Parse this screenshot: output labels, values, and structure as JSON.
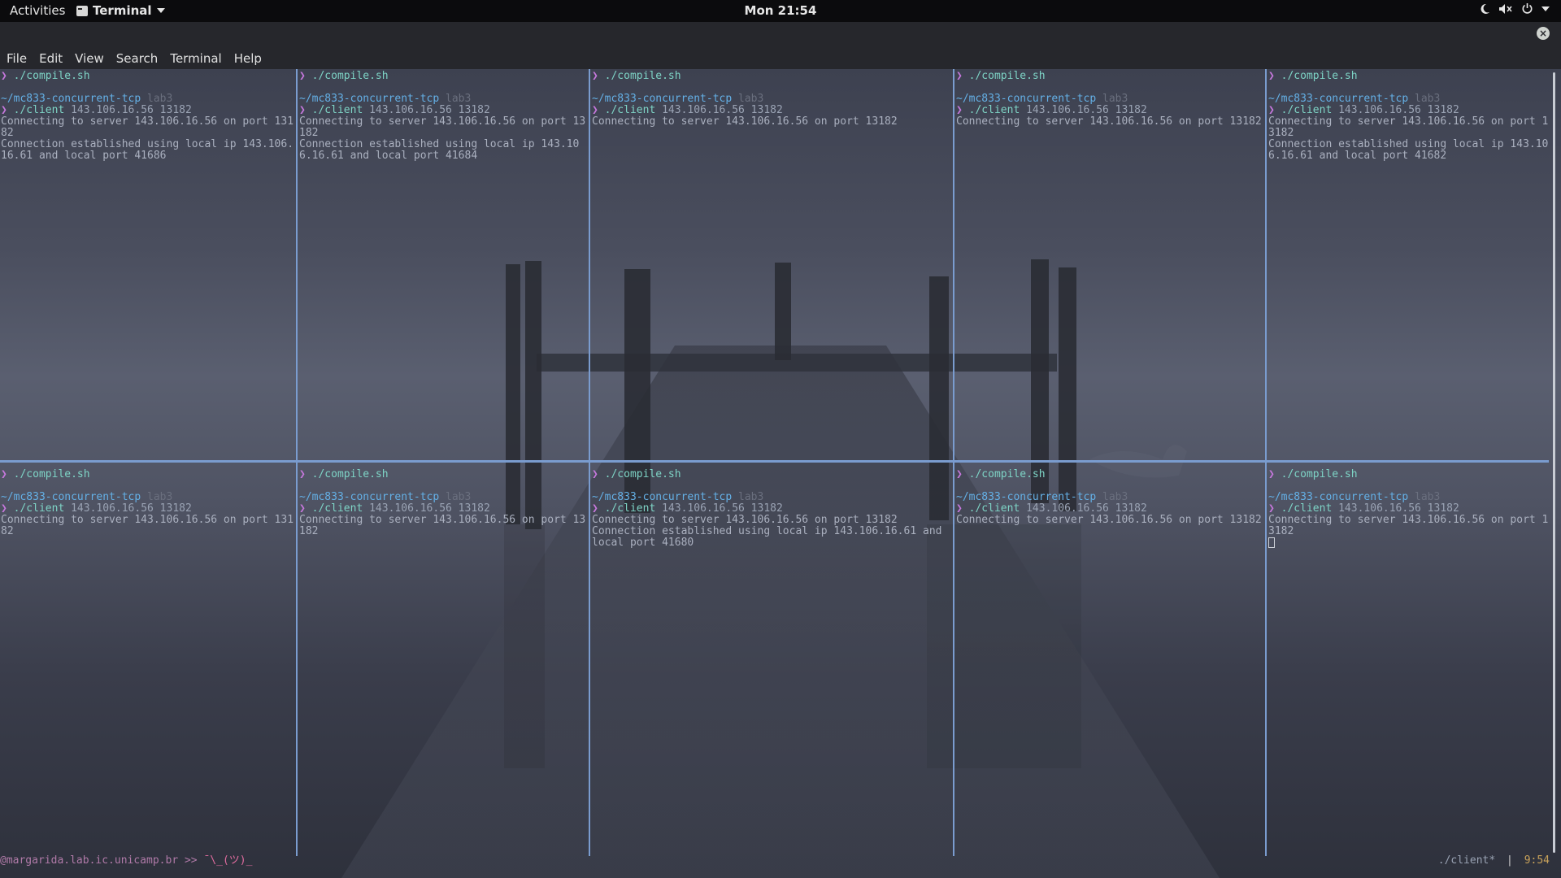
{
  "topbar": {
    "activities": "Activities",
    "app_name": "Terminal",
    "clock": "Mon 21:54",
    "tray_icons": [
      "night-light-icon",
      "volume-muted-icon",
      "power-icon",
      "chevron-down-icon"
    ]
  },
  "menubar": [
    "File",
    "Edit",
    "View",
    "Search",
    "Terminal",
    "Help"
  ],
  "panes": [
    {
      "lines": [
        {
          "sym": "❯",
          "cmd": "./compile.sh",
          "args": ""
        },
        {
          "blank": true
        },
        {
          "path": "~/mc833-concurrent-tcp",
          "branch": "lab3"
        },
        {
          "sym": "❯",
          "cmd": "./client",
          "args": "143.106.16.56 13182"
        },
        {
          "out": "Connecting to server 143.106.16.56 on port 13182"
        },
        {
          "out": "Connection established using local ip 143.106.16.61 and local port 41686"
        }
      ]
    },
    {
      "lines": [
        {
          "sym": "❯",
          "cmd": "./compile.sh",
          "args": ""
        },
        {
          "blank": true
        },
        {
          "path": "~/mc833-concurrent-tcp",
          "branch": "lab3"
        },
        {
          "sym": "❯",
          "cmd": "./client",
          "args": "143.106.16.56 13182"
        },
        {
          "out": "Connecting to server 143.106.16.56 on port 13182"
        },
        {
          "out": "Connection established using local ip 143.106.16.61 and local port 41684"
        }
      ]
    },
    {
      "lines": [
        {
          "sym": "❯",
          "cmd": "./compile.sh",
          "args": ""
        },
        {
          "blank": true
        },
        {
          "path": "~/mc833-concurrent-tcp",
          "branch": "lab3"
        },
        {
          "sym": "❯",
          "cmd": "./client",
          "args": "143.106.16.56 13182"
        },
        {
          "out": "Connecting to server 143.106.16.56 on port 13182"
        }
      ]
    },
    {
      "lines": [
        {
          "sym": "❯",
          "cmd": "./compile.sh",
          "args": ""
        },
        {
          "blank": true
        },
        {
          "path": "~/mc833-concurrent-tcp",
          "branch": "lab3"
        },
        {
          "sym": "❯",
          "cmd": "./client",
          "args": "143.106.16.56 13182"
        },
        {
          "out": "Connecting to server 143.106.16.56 on port 13182"
        }
      ]
    },
    {
      "lines": [
        {
          "sym": "❯",
          "cmd": "./compile.sh",
          "args": ""
        },
        {
          "blank": true
        },
        {
          "path": "~/mc833-concurrent-tcp",
          "branch": "lab3"
        },
        {
          "sym": "❯",
          "cmd": "./client",
          "args": "143.106.16.56 13182"
        },
        {
          "out": "Connecting to server 143.106.16.56 on port 13182"
        },
        {
          "out": "Connection established using local ip 143.106.16.61 and local port 41682"
        }
      ]
    },
    {
      "lines": [
        {
          "sym": "❯",
          "cmd": "./compile.sh",
          "args": ""
        },
        {
          "blank": true
        },
        {
          "path": "~/mc833-concurrent-tcp",
          "branch": "lab3"
        },
        {
          "sym": "❯",
          "cmd": "./client",
          "args": "143.106.16.56 13182"
        },
        {
          "out": "Connecting to server 143.106.16.56 on port 13182"
        }
      ]
    },
    {
      "lines": [
        {
          "sym": "❯",
          "cmd": "./compile.sh",
          "args": ""
        },
        {
          "blank": true
        },
        {
          "path": "~/mc833-concurrent-tcp",
          "branch": "lab3"
        },
        {
          "sym": "❯",
          "cmd": "./client",
          "args": "143.106.16.56 13182"
        },
        {
          "out": "Connecting to server 143.106.16.56 on port 13182"
        }
      ]
    },
    {
      "lines": [
        {
          "sym": "❯",
          "cmd": "./compile.sh",
          "args": ""
        },
        {
          "blank": true
        },
        {
          "path": "~/mc833-concurrent-tcp",
          "branch": "lab3"
        },
        {
          "sym": "❯",
          "cmd": "./client",
          "args": "143.106.16.56 13182"
        },
        {
          "out": "Connecting to server 143.106.16.56 on port 13182"
        },
        {
          "out": "Connection established using local ip 143.106.16.61 and local port 41680"
        }
      ]
    },
    {
      "lines": [
        {
          "sym": "❯",
          "cmd": "./compile.sh",
          "args": ""
        },
        {
          "blank": true
        },
        {
          "path": "~/mc833-concurrent-tcp",
          "branch": "lab3"
        },
        {
          "sym": "❯",
          "cmd": "./client",
          "args": "143.106.16.56 13182"
        },
        {
          "out": "Connecting to server 143.106.16.56 on port 13182"
        }
      ]
    },
    {
      "lines": [
        {
          "sym": "❯",
          "cmd": "./compile.sh",
          "args": ""
        },
        {
          "blank": true
        },
        {
          "path": "~/mc833-concurrent-tcp",
          "branch": "lab3"
        },
        {
          "sym": "❯",
          "cmd": "./client",
          "args": "143.106.16.56 13182"
        },
        {
          "out": "Connecting to server 143.106.16.56 on port 13182"
        },
        {
          "cursor": true
        }
      ]
    }
  ],
  "statusbar": {
    "host": "@margarida.lab.ic.unicamp.br",
    "sep": ">>",
    "shrug": "¯\\_(ツ)_",
    "window": "./client*",
    "divider": "|",
    "time": "9:54"
  }
}
